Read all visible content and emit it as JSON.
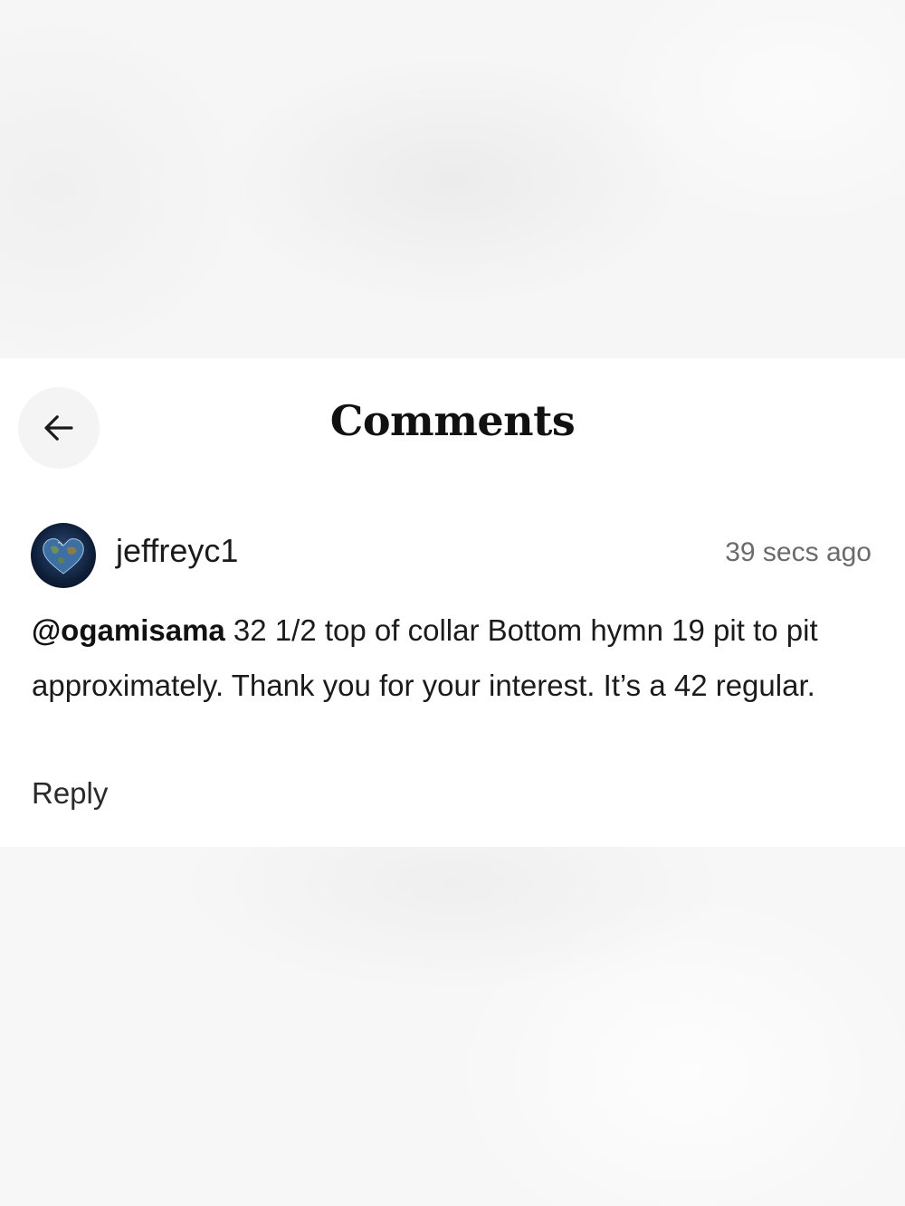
{
  "header": {
    "title": "Comments",
    "back_icon": "arrow-left-icon"
  },
  "comment": {
    "avatar_icon": "earth-heart-avatar",
    "username": "jeffreyc1",
    "timestamp": "39 secs ago",
    "mention": "@ogamisama",
    "text": " 32 1/2 top of collar Bottom hymn 19 pit to pit approximately. Thank you for your interest. It’s a 42 regular.",
    "reply_label": "Reply"
  },
  "colors": {
    "panel_background": "#ffffff",
    "backdrop": "#f7f7f7",
    "back_button_background": "#f4f4f4",
    "timestamp_gray": "#6b6b6b",
    "text_dark": "#1b1b1b"
  }
}
